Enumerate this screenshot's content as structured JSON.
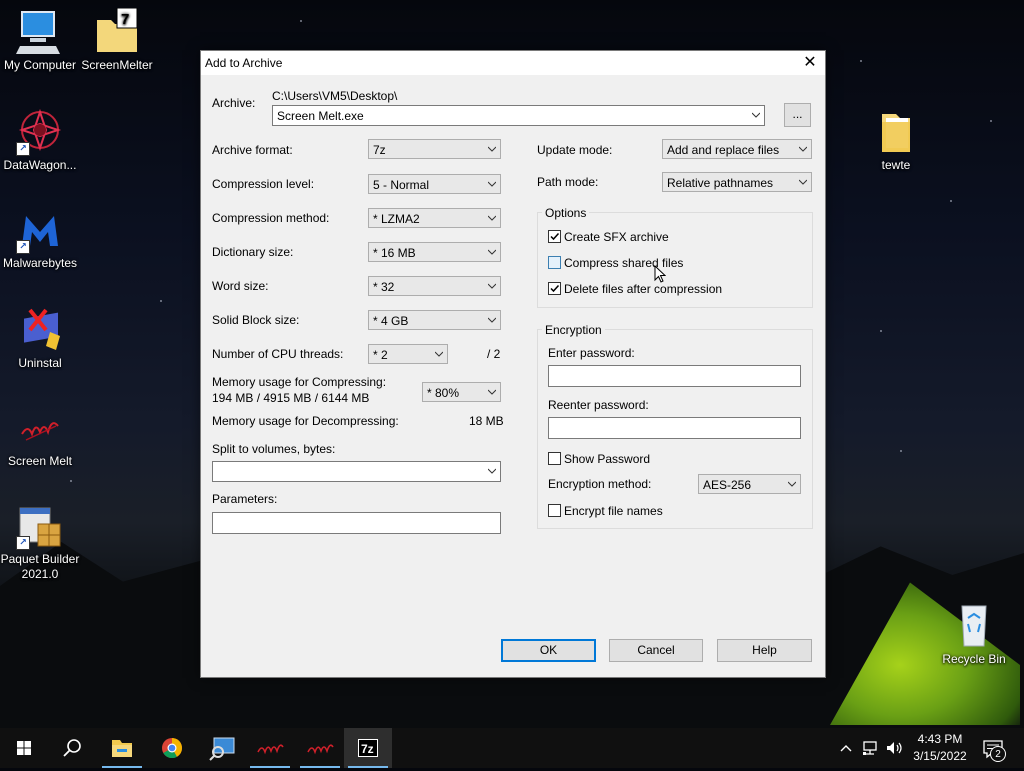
{
  "desktop": {
    "icons": [
      {
        "label": "My Computer"
      },
      {
        "label": "ScreenMelter"
      },
      {
        "label": "DataWagon..."
      },
      {
        "label": "Malwarebytes"
      },
      {
        "label": "Uninstal"
      },
      {
        "label": "Screen Melt"
      },
      {
        "label": "Paquet Builder 2021.0"
      },
      {
        "label": "tewte"
      },
      {
        "label": "Recycle Bin"
      }
    ]
  },
  "dialog": {
    "title": "Add to Archive",
    "archive_label": "Archive:",
    "archive_path": "C:\\Users\\VM5\\Desktop\\",
    "archive_name": "Screen Melt.exe",
    "browse_label": "...",
    "left": {
      "archive_format": {
        "label": "Archive format:",
        "value": "7z"
      },
      "compression_level": {
        "label": "Compression level:",
        "value": "5 - Normal"
      },
      "compression_method": {
        "label": "Compression method:",
        "value": "*  LZMA2"
      },
      "dictionary_size": {
        "label": "Dictionary size:",
        "value": "*  16 MB"
      },
      "word_size": {
        "label": "Word size:",
        "value": "*  32"
      },
      "solid_block_size": {
        "label": "Solid Block size:",
        "value": "*  4 GB"
      },
      "cpu_threads": {
        "label": "Number of CPU threads:",
        "value": "*  2",
        "total": "/ 2"
      },
      "mem_compress": {
        "label": "Memory usage for Compressing:",
        "detail": "194 MB / 4915 MB / 6144 MB",
        "value": "* 80%"
      },
      "mem_decompress": {
        "label": "Memory usage for Decompressing:",
        "value": "18 MB"
      },
      "split_label": "Split to volumes, bytes:",
      "parameters_label": "Parameters:"
    },
    "right": {
      "update_mode": {
        "label": "Update mode:",
        "value": "Add and replace files"
      },
      "path_mode": {
        "label": "Path mode:",
        "value": "Relative pathnames"
      },
      "options_title": "Options",
      "create_sfx": {
        "label": "Create SFX archive",
        "checked": true
      },
      "compress_shared": {
        "label": "Compress shared files",
        "checked": false
      },
      "delete_after": {
        "label": "Delete files after compression",
        "checked": true
      },
      "encryption_title": "Encryption",
      "enter_password_label": "Enter password:",
      "reenter_password_label": "Reenter password:",
      "show_password": {
        "label": "Show Password",
        "checked": false
      },
      "encryption_method": {
        "label": "Encryption method:",
        "value": "AES-256"
      },
      "encrypt_names": {
        "label": "Encrypt file names",
        "checked": false
      }
    },
    "buttons": {
      "ok": "OK",
      "cancel": "Cancel",
      "help": "Help"
    }
  },
  "taskbar": {
    "time": "4:43 PM",
    "date": "3/15/2022",
    "notification_count": "2"
  },
  "colors": {
    "accent": "#0078d7",
    "taskbar": "#101010",
    "dialog_bg": "#f0f0f0"
  }
}
